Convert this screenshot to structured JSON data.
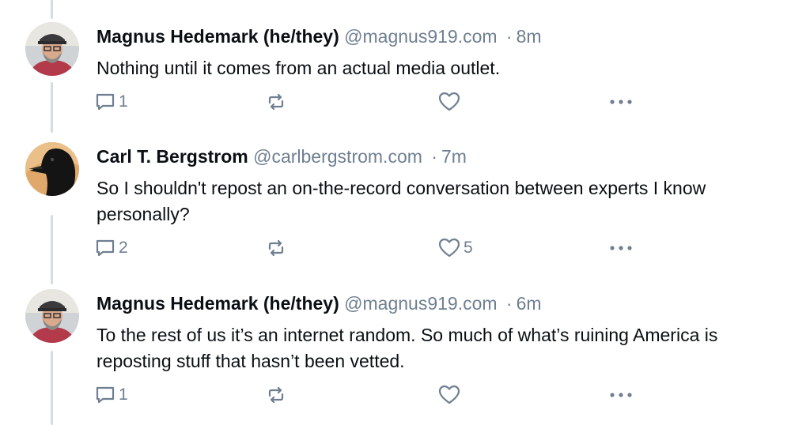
{
  "posts": [
    {
      "author": "Magnus Hedemark (he/they)",
      "handle": "@magnus919.com",
      "separator": "·",
      "time": "8m",
      "text": "Nothing until it comes from an actual media outlet.",
      "reply_count": "1",
      "repost_count": "",
      "like_count": "",
      "avatar": "person-with-cap"
    },
    {
      "author": "Carl T. Bergstrom",
      "handle": "@carlbergstrom.com",
      "separator": "·",
      "time": "7m",
      "text": "So I shouldn't repost an on-the-record conversation between experts I know personally?",
      "reply_count": "2",
      "repost_count": "",
      "like_count": "5",
      "avatar": "crow"
    },
    {
      "author": "Magnus Hedemark (he/they)",
      "handle": "@magnus919.com",
      "separator": "·",
      "time": "6m",
      "text": "To the rest of us it’s an internet random. So much of what’s ruining America is reposting stuff that hasn’t been vetted.",
      "reply_count": "1",
      "repost_count": "",
      "like_count": "",
      "avatar": "person-with-cap"
    }
  ],
  "icons": {
    "reply": "speech-bubble-icon",
    "repost": "repost-arrows-icon",
    "like": "heart-outline-icon",
    "more": "ellipsis-icon"
  },
  "colors": {
    "text": "#0b0f14",
    "muted": "#6f7f91",
    "thread_line": "#d4dbe2"
  }
}
